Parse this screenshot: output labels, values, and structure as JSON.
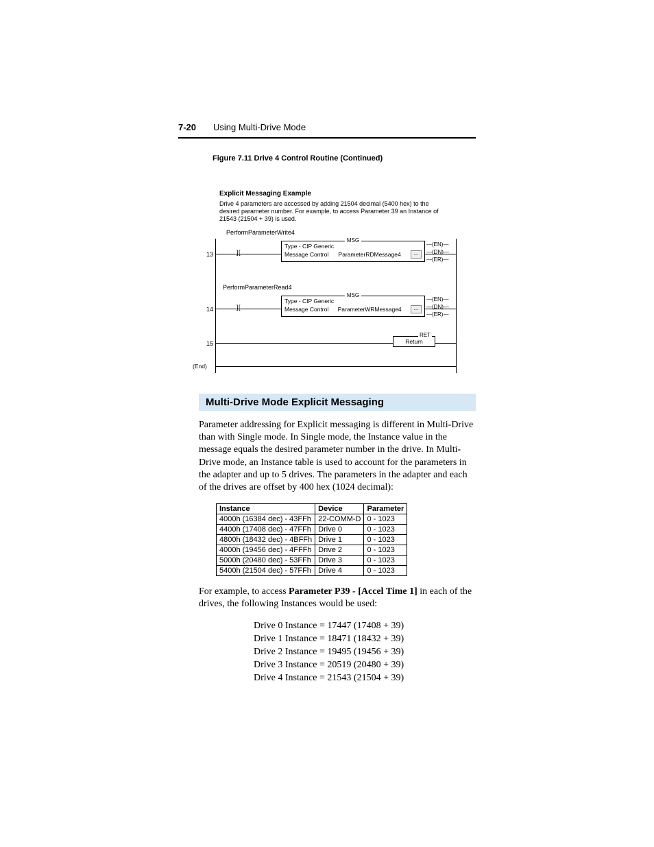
{
  "header": {
    "page_num": "7-20",
    "title": "Using Multi-Drive Mode"
  },
  "figure": {
    "caption": "Figure 7.11    Drive 4 Control Routine (Continued)"
  },
  "ladder": {
    "example_title": "Explicit Messaging Example",
    "example_desc": "Drive 4 parameters are accessed by adding 21504 decimal (5400 hex) to the desired parameter number. For example, to access Parameter 39 an Instance of 21543 (21504 + 39) is used.",
    "rung13": {
      "num": "13",
      "tag": "PerformParameterWrite4",
      "msg_label": "MSG",
      "line1": "Type - CIP Generic",
      "line2a": "Message Control",
      "line2b": "ParameterRDMessage4",
      "pins": [
        "EN",
        "DN",
        "ER"
      ]
    },
    "rung14": {
      "num": "14",
      "tag": "PerformParameterRead4",
      "msg_label": "MSG",
      "line1": "Type - CIP Generic",
      "line2a": "Message Control",
      "line2b": "ParameterWRMessage4",
      "pins": [
        "EN",
        "DN",
        "ER"
      ]
    },
    "rung15": {
      "num": "15",
      "ret_label": "RET",
      "ret_text": "Return"
    },
    "end_label": "(End)"
  },
  "section": {
    "title": "Multi-Drive Mode Explicit Messaging",
    "p1": "Parameter addressing for Explicit messaging is different in Multi-Drive than with Single mode. In Single mode, the Instance value in the message equals the desired parameter number in the drive. In Multi-Drive mode, an Instance table is used to account for the parameters in the adapter and up to 5 drives. The parameters in the adapter and each of the drives are offset by 400 hex (1024 decimal):"
  },
  "table": {
    "headers": [
      "Instance",
      "Device",
      "Parameter"
    ],
    "rows": [
      [
        "4000h (16384 dec) - 43FFh",
        "22-COMM-D",
        "0 - 1023"
      ],
      [
        "4400h (17408 dec) - 47FFh",
        "Drive 0",
        "0 - 1023"
      ],
      [
        "4800h (18432 dec) - 4BFFh",
        "Drive 1",
        "0 - 1023"
      ],
      [
        "4000h (19456 dec) - 4FFFh",
        "Drive 2",
        "0 - 1023"
      ],
      [
        "5000h (20480 dec) - 53FFh",
        "Drive 3",
        "0 - 1023"
      ],
      [
        "5400h (21504 dec) - 57FFh",
        "Drive 4",
        "0 - 1023"
      ]
    ]
  },
  "example": {
    "intro_pre": "For example, to access ",
    "intro_bold": "Parameter P39 - [Accel Time 1]",
    "intro_post": " in each of the drives, the following Instances would be used:",
    "lines": [
      "Drive 0 Instance = 17447 (17408 + 39)",
      "Drive 1 Instance = 18471 (18432 + 39)",
      "Drive 2 Instance = 19495 (19456 + 39)",
      "Drive 3 Instance = 20519 (20480 + 39)",
      "Drive 4 Instance = 21543 (21504 + 39)"
    ]
  }
}
